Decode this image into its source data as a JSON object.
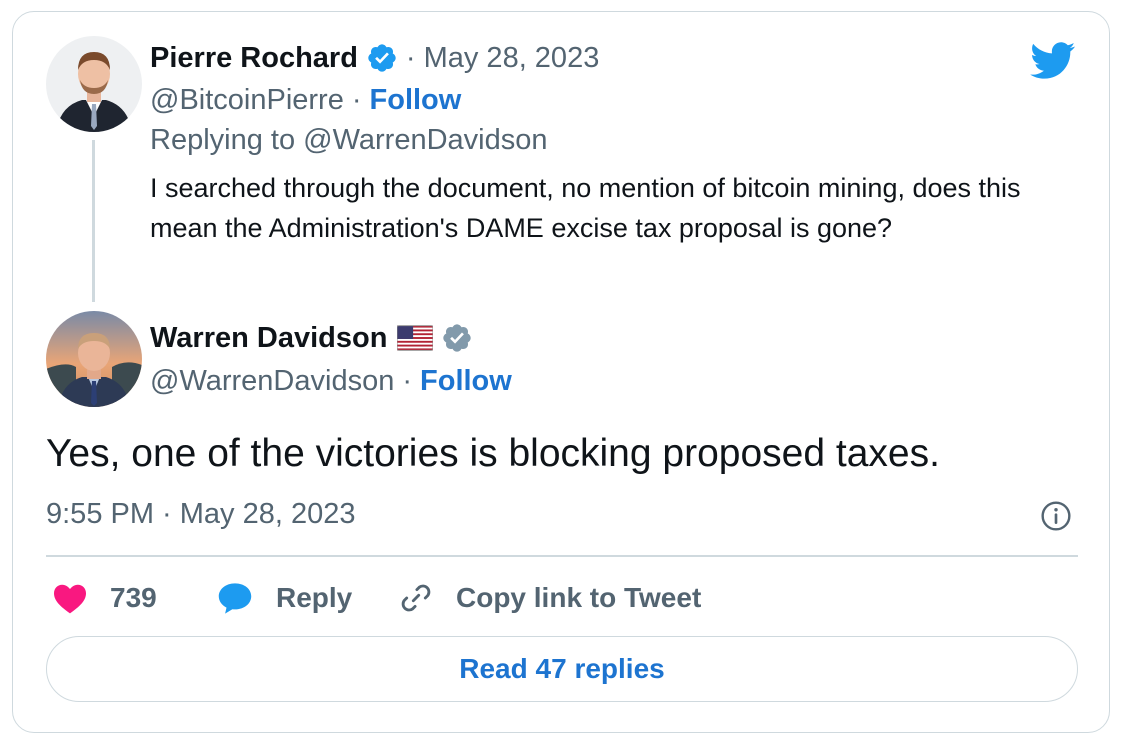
{
  "reply_tweet": {
    "author_name": "Pierre Rochard",
    "date": "May 28, 2023",
    "handle": "@BitcoinPierre",
    "follow_label": "Follow",
    "replying_to": "Replying to @WarrenDavidson",
    "text": "I searched through the document, no mention of bitcoin mining, does this mean the Administration's DAME excise tax proposal is gone?"
  },
  "main_tweet": {
    "author_name": "Warren Davidson",
    "handle": "@WarrenDavidson",
    "follow_label": "Follow",
    "text": "Yes, one of the victories is blocking proposed taxes.",
    "timestamp": "9:55 PM · May 28, 2023"
  },
  "actions": {
    "likes": "739",
    "reply_label": "Reply",
    "copy_link_label": "Copy link to Tweet"
  },
  "read_replies_label": "Read 47 replies",
  "separator": "·",
  "icons": [
    "twitter-bird-icon",
    "verified-badge-icon",
    "us-flag-icon",
    "info-icon",
    "heart-icon",
    "reply-bubble-icon",
    "link-icon"
  ],
  "colors": {
    "twitter_blue": "#1d9bf0",
    "follow_blue": "#1d74d0",
    "heart_pink": "#f91880",
    "muted_text": "#536471",
    "border": "#cfd9de",
    "verified_grey": "#829aab"
  }
}
